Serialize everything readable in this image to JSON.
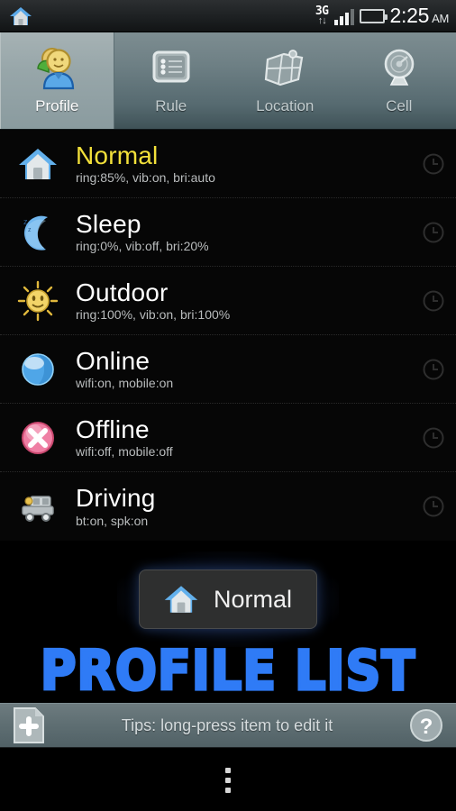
{
  "statusbar": {
    "home_icon": "home-icon",
    "network_label": "3G",
    "network_arrows": "↑↓",
    "signal_icon": "signal-bars-icon",
    "battery_icon": "battery-icon",
    "time": "2:25",
    "ampm": "AM"
  },
  "tabs": [
    {
      "label": "Profile",
      "icon": "profile-people-icon",
      "active": true
    },
    {
      "label": "Rule",
      "icon": "rule-list-icon",
      "active": false
    },
    {
      "label": "Location",
      "icon": "location-map-icon",
      "active": false
    },
    {
      "label": "Cell",
      "icon": "cell-antenna-icon",
      "active": false
    }
  ],
  "profiles": [
    {
      "title": "Normal",
      "subtitle": "ring:85%, vib:on, bri:auto",
      "icon": "house-icon",
      "active": true,
      "timer_icon": "clock-icon"
    },
    {
      "title": "Sleep",
      "subtitle": "ring:0%, vib:off, bri:20%",
      "icon": "moon-icon",
      "active": false,
      "timer_icon": "clock-icon"
    },
    {
      "title": "Outdoor",
      "subtitle": "ring:100%, vib:on, bri:100%",
      "icon": "sun-icon",
      "active": false,
      "timer_icon": "clock-icon"
    },
    {
      "title": "Online",
      "subtitle": "wifi:on, mobile:on",
      "icon": "globe-icon",
      "active": false,
      "timer_icon": "clock-icon"
    },
    {
      "title": "Offline",
      "subtitle": "wifi:off, mobile:off",
      "icon": "cross-circle-icon",
      "active": false,
      "timer_icon": "clock-icon"
    },
    {
      "title": "Driving",
      "subtitle": "bt:on, spk:on",
      "icon": "car-icon",
      "active": false,
      "timer_icon": "clock-icon"
    }
  ],
  "toast": {
    "label": "Normal",
    "icon": "house-icon"
  },
  "watermark": {
    "text": "PROFILE LIST",
    "color": "#2f7bf6"
  },
  "bottombar": {
    "add_icon": "add-page-icon",
    "tips": "Tips: long-press item to edit it",
    "help_icon": "help-question-icon"
  },
  "navbar": {
    "overflow_icon": "overflow-menu-icon"
  },
  "colors": {
    "active_profile": "#f2e03a",
    "accent_blue": "#2f7bf6",
    "battery_green": "#62b422",
    "list_bg": "#060606"
  }
}
